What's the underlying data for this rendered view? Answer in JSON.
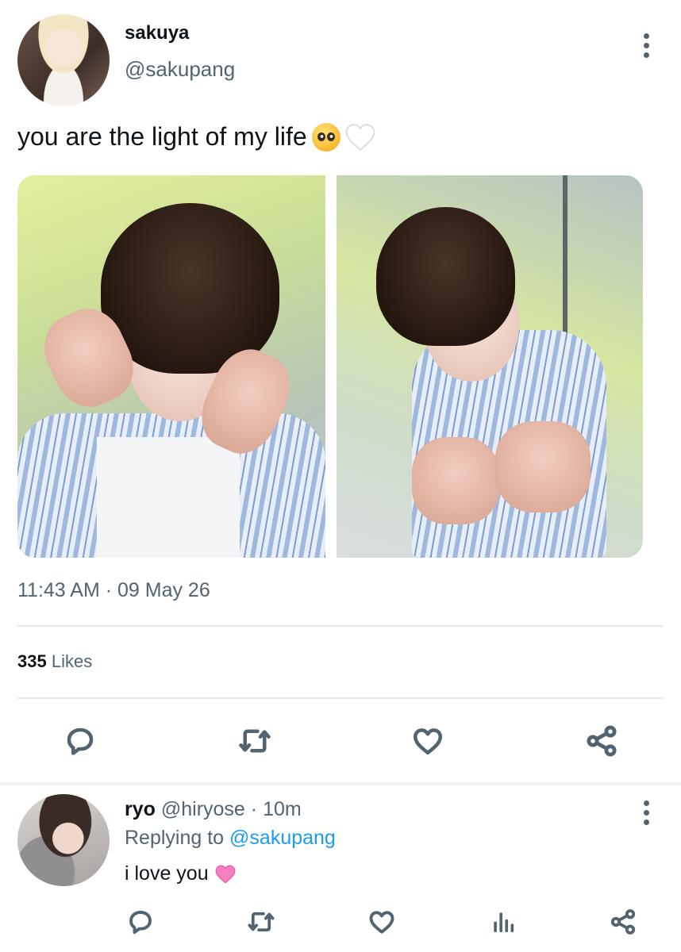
{
  "tweet": {
    "display_name": "sakuya",
    "handle": "@sakupang",
    "text": "you are the light of my life",
    "emojis": [
      "pleading-face",
      "white-heart"
    ],
    "timestamp": "11:43 AM · 09 May 26",
    "likes_count": "335",
    "likes_label": "Likes",
    "photos": [
      "photo-heart-hands",
      "photo-open-palms"
    ],
    "actions": [
      "reply-icon",
      "retweet-icon",
      "like-icon",
      "share-icon"
    ]
  },
  "reply": {
    "display_name": "ryo",
    "handle": "@hiryose",
    "time": "· 10m",
    "replying_prefix": "Replying to",
    "replying_to": "@sakupang",
    "text": "i love you",
    "emoji": "pink-heart",
    "actions": [
      "reply-icon",
      "retweet-icon",
      "like-icon",
      "analytics-icon",
      "share-icon"
    ]
  },
  "colors": {
    "text": "#0f1419",
    "secondary": "#536471",
    "link": "#1d9bf0",
    "divider": "#e3e6ea"
  }
}
